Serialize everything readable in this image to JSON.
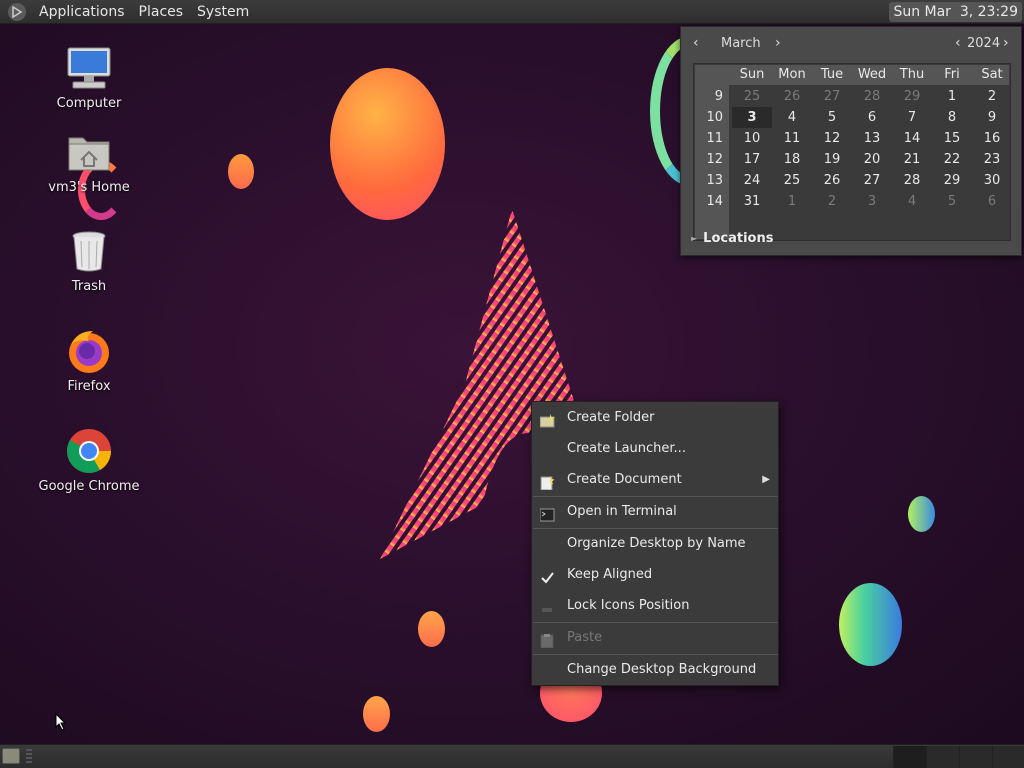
{
  "top_panel": {
    "menus": [
      "Applications",
      "Places",
      "System"
    ],
    "clock": "Sun Mar  3, 23:29"
  },
  "desktop_icons": [
    {
      "label": "Computer",
      "icon": "computer-icon"
    },
    {
      "label": "vm3's Home",
      "icon": "home-folder-icon"
    },
    {
      "label": "Trash",
      "icon": "trash-icon"
    },
    {
      "label": "Firefox",
      "icon": "firefox-icon"
    },
    {
      "label": "Google Chrome",
      "icon": "chrome-icon"
    }
  ],
  "calendar": {
    "month": "March",
    "year": "2024",
    "weekday_headers": [
      "Sun",
      "Mon",
      "Tue",
      "Wed",
      "Thu",
      "Fri",
      "Sat"
    ],
    "weeks": [
      {
        "week": "9",
        "days": [
          "25",
          "26",
          "27",
          "28",
          "29",
          "1",
          "2"
        ],
        "dim": [
          true,
          true,
          true,
          true,
          true,
          false,
          false
        ]
      },
      {
        "week": "10",
        "days": [
          "3",
          "4",
          "5",
          "6",
          "7",
          "8",
          "9"
        ],
        "dim": [
          false,
          false,
          false,
          false,
          false,
          false,
          false
        ]
      },
      {
        "week": "11",
        "days": [
          "10",
          "11",
          "12",
          "13",
          "14",
          "15",
          "16"
        ],
        "dim": [
          false,
          false,
          false,
          false,
          false,
          false,
          false
        ]
      },
      {
        "week": "12",
        "days": [
          "17",
          "18",
          "19",
          "20",
          "21",
          "22",
          "23"
        ],
        "dim": [
          false,
          false,
          false,
          false,
          false,
          false,
          false
        ]
      },
      {
        "week": "13",
        "days": [
          "24",
          "25",
          "26",
          "27",
          "28",
          "29",
          "30"
        ],
        "dim": [
          false,
          false,
          false,
          false,
          false,
          false,
          false
        ]
      },
      {
        "week": "14",
        "days": [
          "31",
          "1",
          "2",
          "3",
          "4",
          "5",
          "6"
        ],
        "dim": [
          false,
          true,
          true,
          true,
          true,
          true,
          true
        ]
      }
    ],
    "today": "3",
    "locations_label": "Locations"
  },
  "context_menu": {
    "items": [
      {
        "label": "Create Folder",
        "icon": "new-folder-icon",
        "enabled": true
      },
      {
        "label": "Create Launcher...",
        "icon": "",
        "enabled": true
      },
      {
        "label": "Create Document",
        "icon": "new-document-icon",
        "enabled": true,
        "submenu": true
      },
      {
        "label": "Open in Terminal",
        "icon": "terminal-icon",
        "enabled": true
      },
      {
        "label": "Organize Desktop by Name",
        "icon": "",
        "enabled": true
      },
      {
        "label": "Keep Aligned",
        "icon": "checkmark-icon",
        "enabled": true,
        "checked": true
      },
      {
        "label": "Lock Icons Position",
        "icon": "lock-icon",
        "enabled": true
      },
      {
        "label": "Paste",
        "icon": "paste-icon",
        "enabled": false
      },
      {
        "label": "Change Desktop Background",
        "icon": "",
        "enabled": true
      }
    ]
  },
  "colors": {
    "desktop_bg": "#2b0f2d",
    "panel_bg": "#333333",
    "menu_bg": "#3b3b3b"
  }
}
